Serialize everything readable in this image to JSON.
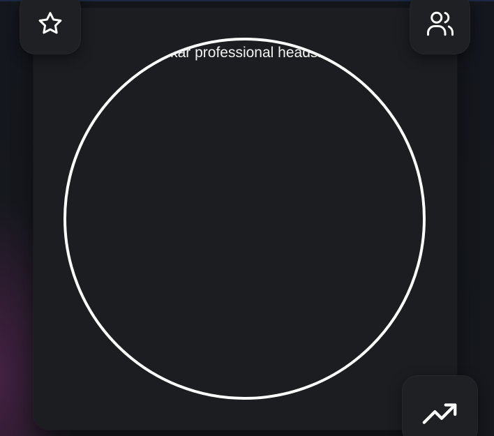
{
  "avatar": {
    "caption": "Ankar professional headshot"
  },
  "actions": {
    "favorite_icon": "star-icon",
    "people_icon": "users-icon",
    "trend_icon": "trending-up-icon"
  },
  "colors": {
    "background": "#15171c",
    "card": "#1c1d21",
    "ring": "#ffffff",
    "tile": "#1e2024",
    "accent_glow": "#6e2864"
  }
}
